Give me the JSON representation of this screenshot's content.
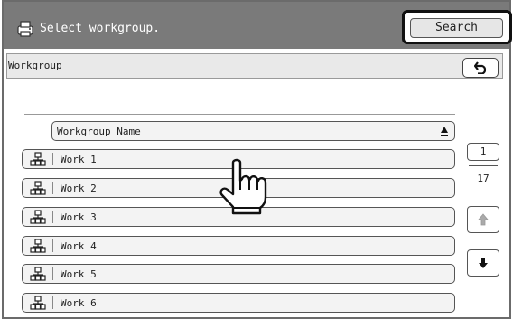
{
  "header": {
    "title": "Select workgroup.",
    "search_label": "Search",
    "icon": "printer-icon"
  },
  "path_bar": {
    "label": "Workgroup",
    "back_icon": "return-arrow-icon"
  },
  "list": {
    "column_header": "Workgroup Name",
    "sort_icon": "sort-ascending-icon",
    "item_icon": "workgroup-icon",
    "items": [
      {
        "name": "Work 1"
      },
      {
        "name": "Work 2"
      },
      {
        "name": "Work 3"
      },
      {
        "name": "Work 4"
      },
      {
        "name": "Work 5"
      },
      {
        "name": "Work 6"
      }
    ]
  },
  "pagination": {
    "current_page": "1",
    "total_pages": "17",
    "up_icon": "arrow-up-icon",
    "down_icon": "arrow-down-icon"
  },
  "pointer": "hand-pointer-icon",
  "colors": {
    "title_bar": "#7a7a7a",
    "row_fill": "#f3f3f3",
    "border": "#555555"
  }
}
